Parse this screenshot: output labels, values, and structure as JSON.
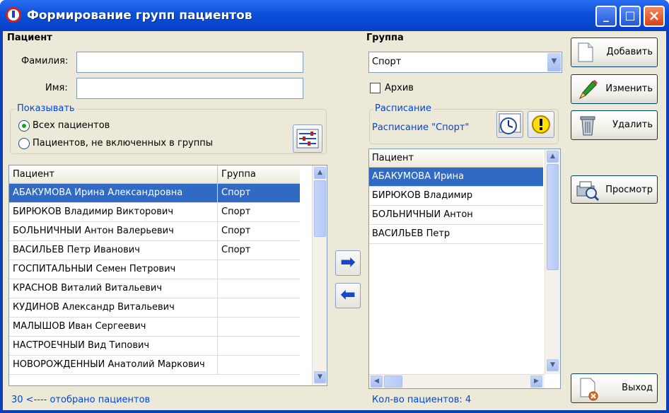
{
  "window": {
    "title": "Формирование групп пациентов"
  },
  "patient_section": {
    "header": "Пациент",
    "surname_label": "Фамилия:",
    "surname_value": "",
    "name_label": "Имя:",
    "name_value": ""
  },
  "show_group": {
    "title": "Показывать",
    "options": [
      {
        "label": "Всех пациентов",
        "selected": true
      },
      {
        "label": "Пациентов, не включенных в группы",
        "selected": false
      }
    ]
  },
  "patients_table": {
    "columns": [
      "Пациент",
      "Группа"
    ],
    "rows": [
      {
        "patient": "АБАКУМОВА Ирина Александровна",
        "group": "Спорт",
        "selected": true
      },
      {
        "patient": "БИРЮКОВ Владимир Викторович",
        "group": "Спорт"
      },
      {
        "patient": "БОЛЬНИЧНЫЙ Антон Валерьевич",
        "group": "Спорт"
      },
      {
        "patient": "ВАСИЛЬЕВ Петр Иванович",
        "group": "Спорт"
      },
      {
        "patient": "ГОСПИТАЛЬНЫЙ Семен Петрович",
        "group": ""
      },
      {
        "patient": "КРАСНОВ Виталий Витальевич",
        "group": ""
      },
      {
        "patient": "КУДИНОВ Александр Витальевич",
        "group": ""
      },
      {
        "patient": "МАЛЫШОВ Иван Сергеевич",
        "group": ""
      },
      {
        "patient": "НАСТРОЕЧНЫЙ Вид Типович",
        "group": ""
      },
      {
        "patient": "НОВОРОЖДЕННЫЙ Анатолий Маркович",
        "group": ""
      }
    ],
    "footer": "30  <---- отобрано пациентов"
  },
  "group_section": {
    "header": "Группа",
    "selected_group": "Спорт",
    "archive_label": "Архив",
    "schedule_title": "Расписание",
    "schedule_text": "Расписание \"Спорт\""
  },
  "group_table": {
    "columns": [
      "Пациент"
    ],
    "rows": [
      {
        "patient": "АБАКУМОВА Ирина",
        "selected": true
      },
      {
        "patient": "БИРЮКОВ Владимир"
      },
      {
        "patient": "БОЛЬНИЧНЫЙ Антон"
      },
      {
        "patient": "ВАСИЛЬЕВ Петр"
      }
    ],
    "footer": "Кол-во пациентов: 4"
  },
  "buttons": {
    "add": "Добавить",
    "edit": "Изменить",
    "delete": "Удалить",
    "preview": "Просмотр",
    "exit": "Выход"
  },
  "colors": {
    "titlebar": "#0b4fd8",
    "selection": "#316ac5",
    "accent_text": "#0046d5"
  }
}
